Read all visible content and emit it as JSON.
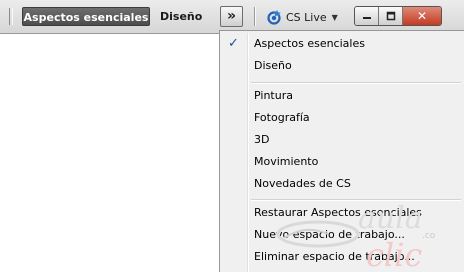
{
  "toolbar": {
    "workspace_active_label": "Aspectos esenciales",
    "workspace_design_label": "Diseño",
    "more_label": "»",
    "cslive_label": "CS Live",
    "cslive_icon": "cslive-gear-icon",
    "window_buttons": [
      "minimize-icon",
      "restore-icon",
      "close-icon"
    ]
  },
  "menu": {
    "items": [
      {
        "label": "Aspectos esenciales",
        "checked": true
      },
      {
        "label": "Diseño",
        "checked": false
      },
      {
        "label": "Pintura",
        "checked": false
      },
      {
        "label": "Fotografía",
        "checked": false
      },
      {
        "label": "3D",
        "checked": false
      },
      {
        "label": "Movimiento",
        "checked": false
      },
      {
        "label": "Novedades de CS",
        "checked": false
      },
      {
        "label": "Restaurar Aspectos esenciales",
        "checked": false
      },
      {
        "label": "Nuevo espacio de trabajo...",
        "checked": false
      },
      {
        "label": "Eliminar espacio de trabajo...",
        "checked": false
      }
    ],
    "check_mark": "✓"
  },
  "watermark": {
    "word1": "aula",
    "word2": "clic",
    "word3": ".com"
  },
  "colors": {
    "active_workspace_bg": "#5a5a5a",
    "menu_bg": "#f0f0f0",
    "check_color": "#1e4d9b",
    "close_button": "#c8402a"
  }
}
